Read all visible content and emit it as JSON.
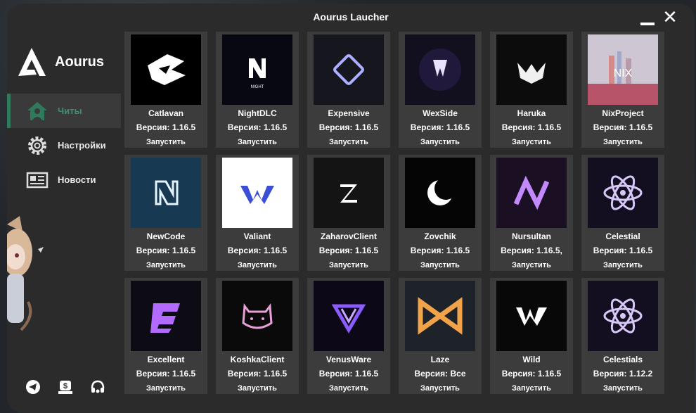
{
  "window": {
    "title": "Aourus Laucher"
  },
  "brand": {
    "name": "Aourus"
  },
  "nav": [
    {
      "label": "Читы",
      "icon": "home-icon",
      "active": true
    },
    {
      "label": "Настройки",
      "icon": "gear-icon",
      "active": false
    },
    {
      "label": "Новости",
      "icon": "newspaper-icon",
      "active": false
    }
  ],
  "social": [
    "telegram-icon",
    "donate-icon",
    "support-icon"
  ],
  "colors": {
    "accent": "#2f7a5b",
    "card": "#3c3c3c",
    "window": "#2b2b2b"
  },
  "launch_label": "Запустить",
  "cards": [
    {
      "name": "Catlavan",
      "version": "Версия: 1.16.5",
      "icon": "catlavan-logo"
    },
    {
      "name": "NightDLC",
      "version": "Версия: 1.16.5",
      "icon": "nightdlc-logo"
    },
    {
      "name": "Expensive",
      "version": "Версия: 1.16.5",
      "icon": "expensive-logo"
    },
    {
      "name": "WexSide",
      "version": "Версия: 1.16.5",
      "icon": "wexside-logo"
    },
    {
      "name": "Haruka",
      "version": "Версия: 1.16.5",
      "icon": "haruka-logo"
    },
    {
      "name": "NixProject",
      "version": "Версия: 1.16.5",
      "icon": "nixproject-logo"
    },
    {
      "name": "NewCode",
      "version": "Версия: 1.16.5",
      "icon": "newcode-logo"
    },
    {
      "name": "Valiant",
      "version": "Версия: 1.16.5",
      "icon": "valiant-logo"
    },
    {
      "name": "ZaharovClient",
      "version": "Версия: 1.16.5",
      "icon": "zaharov-logo"
    },
    {
      "name": "Zovchik",
      "version": "Версия: 1.16.5",
      "icon": "zovchik-logo"
    },
    {
      "name": "Nursultan",
      "version": "Версия: 1.16.5,",
      "icon": "nursultan-logo"
    },
    {
      "name": "Celestial",
      "version": "Версия: 1.16.5",
      "icon": "celestial-logo"
    },
    {
      "name": "Excellent",
      "version": "Версия: 1.16.5",
      "icon": "excellent-logo"
    },
    {
      "name": "KoshkaClient",
      "version": "Версия: 1.16.5",
      "icon": "koshka-logo"
    },
    {
      "name": "VenusWare",
      "version": "Версия: 1.16.5",
      "icon": "venusware-logo"
    },
    {
      "name": "Laze",
      "version": "Версия: Все",
      "icon": "laze-logo"
    },
    {
      "name": "Wild",
      "version": "Версия: 1.16.5",
      "icon": "wild-logo"
    },
    {
      "name": "Celestials",
      "version": "Версия: 1.12.2",
      "icon": "celestials-logo"
    }
  ]
}
